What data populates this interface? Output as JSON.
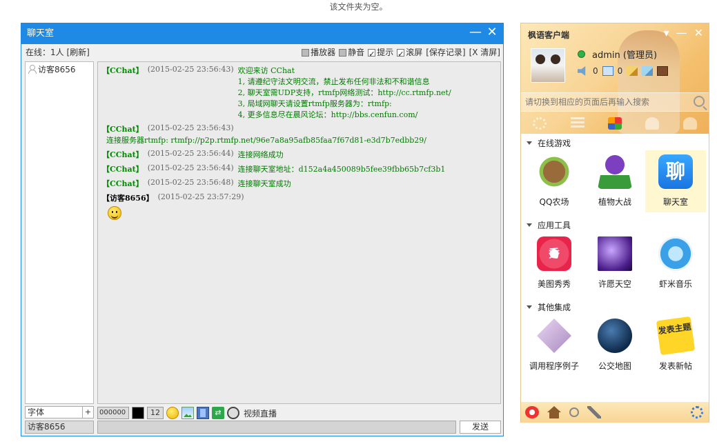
{
  "top_notice": "该文件夹为空。",
  "chat": {
    "title": "聊天室",
    "minimize": "—",
    "close": "✕",
    "online_label": "在线：1人 [刷新]",
    "options": {
      "player": "播放器",
      "mute": "静音",
      "notify": "提示",
      "scroll": "滚屏",
      "save": "[保存记录]",
      "clear": "[X 清屏]"
    },
    "users": [
      "访客8656"
    ],
    "messages": [
      {
        "sender": "【CChat】",
        "time": "(2015-02-25 23:56:43)",
        "text": "欢迎来访 CChat",
        "lines": [
          "1, 请遵纪守法文明交流，禁止发布任何非法和不和谐信息",
          "2, 聊天室需UDP支持，rtmfp网络测试：http://cc.rtmfp.net/",
          "3, 局域网聊天请设置rtmfp服务器为：rtmfp:",
          "4, 更多信息尽在晨风论坛：http://bbs.cenfun.com/"
        ]
      },
      {
        "sender": "【CChat】",
        "time": "(2015-02-25 23:56:43)",
        "text": "",
        "body": "连接服务器rtmfp: rtmfp://p2p.rtmfp.net/96e7a8a95afb85faa7f67d81-e3d7b7edbb29/"
      },
      {
        "sender": "【CChat】",
        "time": "(2015-02-25 23:56:44)",
        "text": "连接网络成功"
      },
      {
        "sender": "【CChat】",
        "time": "(2015-02-25 23:56:44)",
        "text": "连接聊天室地址：d152a4a450089b5fee39fbb65b7cf3b1"
      },
      {
        "sender": "【CChat】",
        "time": "(2015-02-25 23:56:48)",
        "text": "连接聊天室成功"
      },
      {
        "sender": "【访客8656】",
        "time": "(2015-02-25 23:57:29)",
        "emoji": "smiley"
      }
    ],
    "font_label": "字体",
    "font_plus": "+",
    "color_code": "000000",
    "color_value": "#000000",
    "font_size": "12",
    "video_label": "视频直播",
    "current_user": "访客8656",
    "send_label": "发送",
    "accent_color": "#1e8ae6"
  },
  "client": {
    "title": "枫语客户端",
    "username": "admin",
    "role": "(管理员)",
    "stat_volume": "0",
    "stat_mail": "0",
    "search_placeholder": "请切换到相应的页面后再输入搜索",
    "sections": [
      {
        "title": "在线游戏",
        "apps": [
          {
            "label": "QQ农场",
            "icon": "farm-icon"
          },
          {
            "label": "植物大战",
            "icon": "plant-icon"
          },
          {
            "label": "聊天室",
            "icon": "chat-icon",
            "icon_text": "聊",
            "selected": true
          }
        ]
      },
      {
        "title": "应用工具",
        "apps": [
          {
            "label": "美图秀秀",
            "icon": "meitu-icon",
            "icon_text": "秀"
          },
          {
            "label": "许愿天空",
            "icon": "wish-sky-icon"
          },
          {
            "label": "虾米音乐",
            "icon": "music-icon"
          }
        ]
      },
      {
        "title": "其他集成",
        "apps": [
          {
            "label": "调用程序例子",
            "icon": "example-icon"
          },
          {
            "label": "公交地图",
            "icon": "globe-icon"
          },
          {
            "label": "发表新帖",
            "icon": "post-icon",
            "icon_text": "发表主题"
          }
        ]
      }
    ]
  }
}
